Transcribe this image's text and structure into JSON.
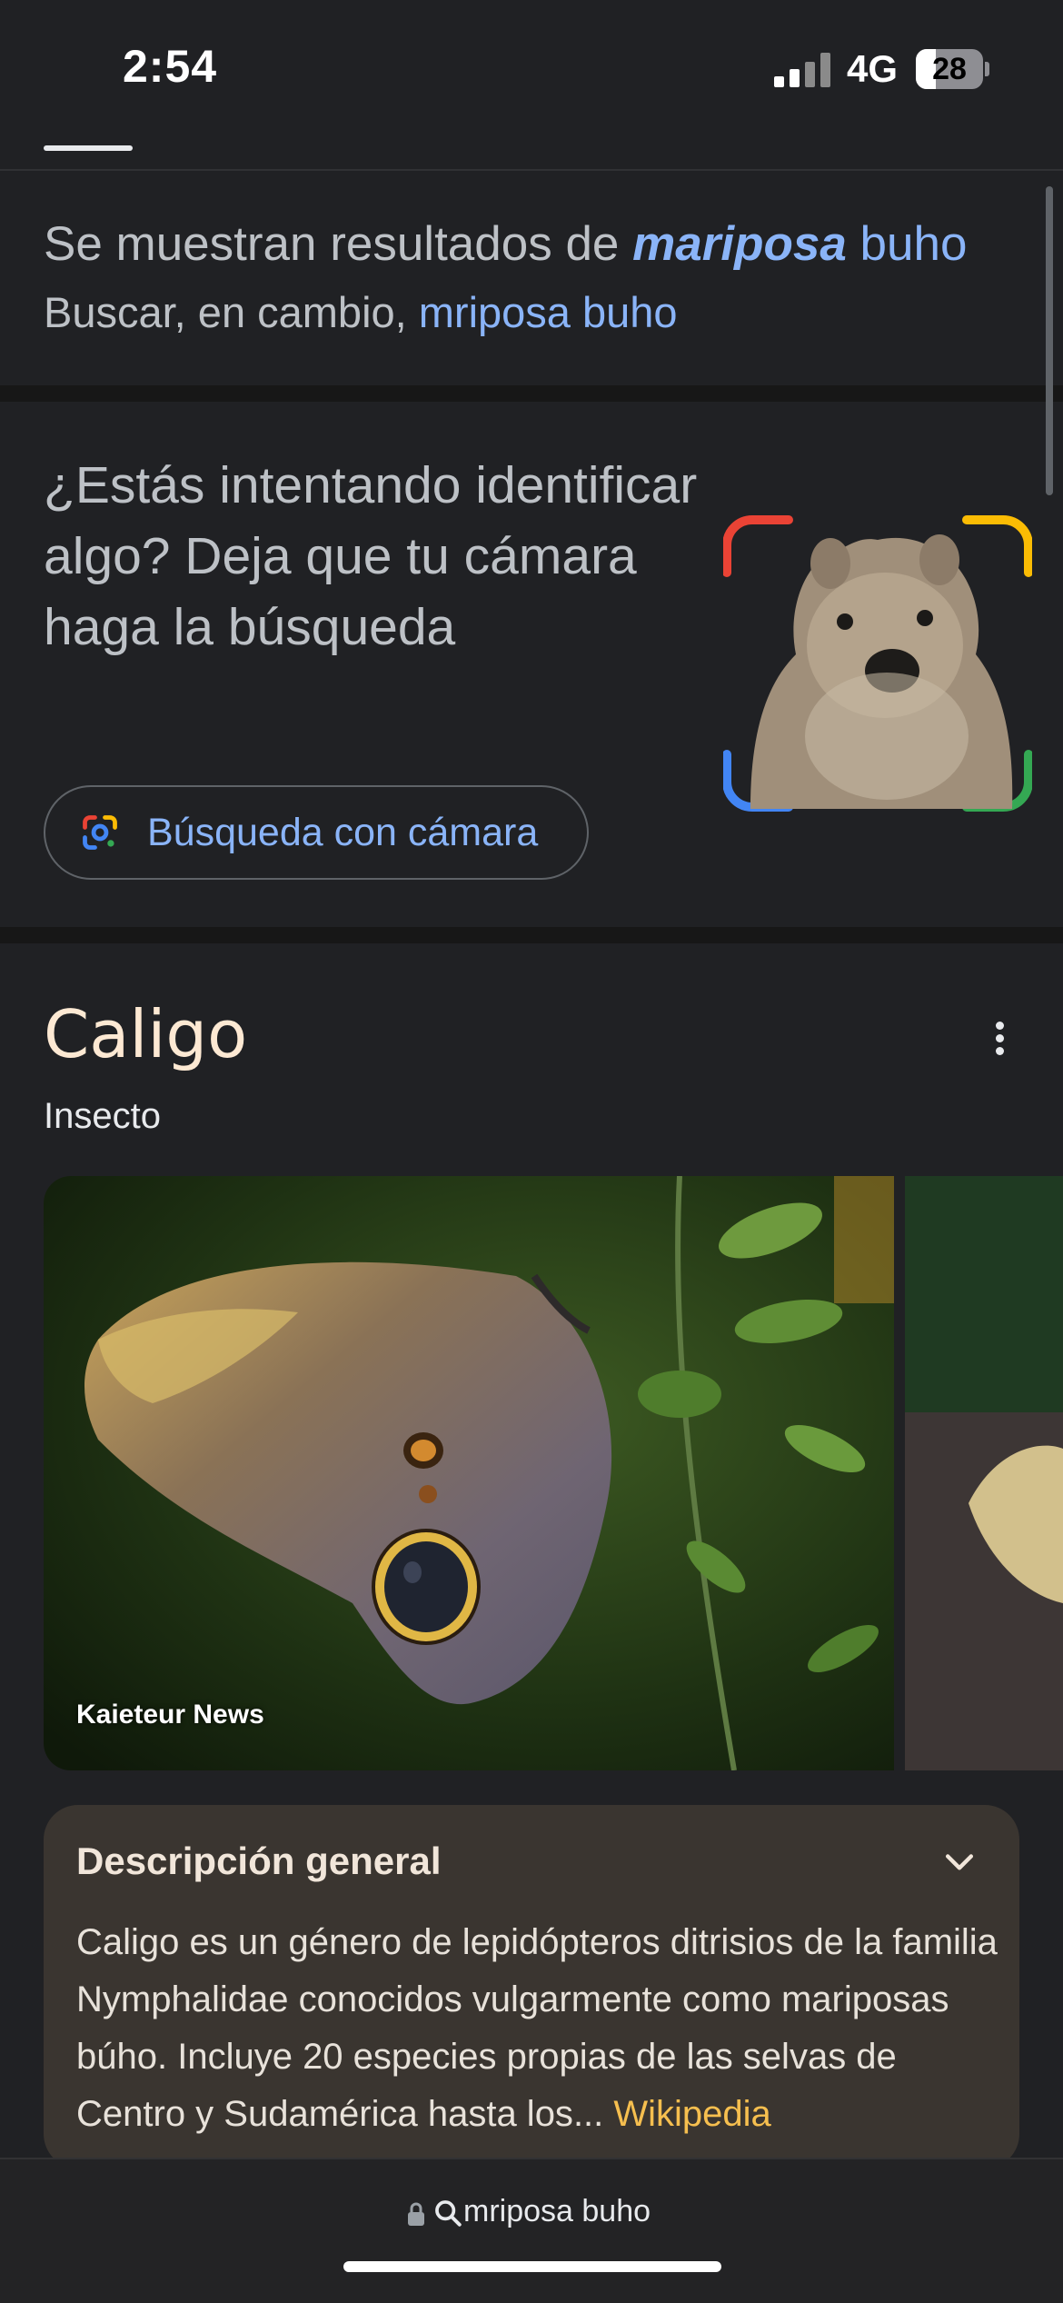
{
  "status": {
    "time": "2:54",
    "network": "4G",
    "battery": "28"
  },
  "spelling": {
    "showing_prefix": "Se muestran resultados de ",
    "corrected_emphasis": "mariposa",
    "corrected_rest": " buho",
    "instead_prefix": "Buscar, en cambio, ",
    "original_query": "mriposa buho"
  },
  "camera_promo": {
    "title": "¿Estás intentando identificar algo? Deja que tu cámara haga la búsqueda",
    "button_label": "Búsqueda con cámara"
  },
  "knowledge_panel": {
    "title": "Caligo",
    "subtitle": "Insecto",
    "image_source": "Kaieteur News",
    "overview_heading": "Descripción general",
    "overview_text": "Caligo es un género de lepidópteros ditrisios de la familia Nymphalidae conocidos vulgarmente como mariposas búho. Incluye 20 especies propias de las selvas de Centro y Sudamérica hasta los",
    "overview_ellipsis": "... ",
    "overview_source": "Wikipedia"
  },
  "address_bar": {
    "query": "mriposa buho"
  },
  "colors": {
    "background": "#202124",
    "link": "#8ab4f8",
    "title_accent": "#fde9d3",
    "source_link": "#f6bf4f"
  },
  "icons": [
    "signal-icon",
    "battery-icon",
    "google-lens-icon",
    "more-vert-icon",
    "chevron-down-icon",
    "lock-icon",
    "search-icon"
  ]
}
